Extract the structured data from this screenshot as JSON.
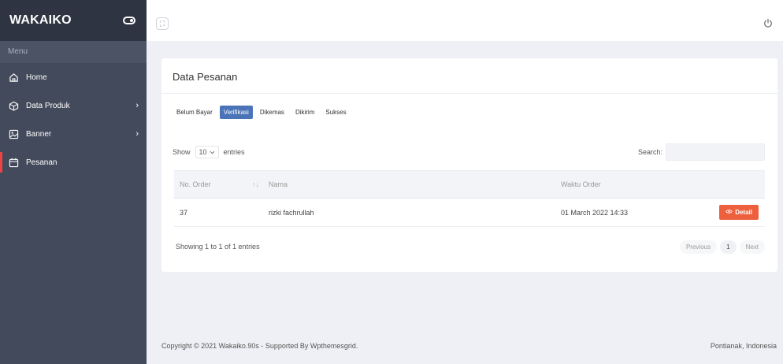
{
  "brand": {
    "name": "WAKAIKO"
  },
  "sidebar": {
    "heading": "Menu",
    "items": [
      {
        "label": "Home",
        "icon": "home-icon"
      },
      {
        "label": "Data Produk",
        "icon": "box-icon",
        "chevron": "›"
      },
      {
        "label": "Banner",
        "icon": "image-icon",
        "chevron": "›"
      },
      {
        "label": "Pesanan",
        "icon": "calendar-icon",
        "active": true
      }
    ]
  },
  "card": {
    "title": "Data Pesanan",
    "tabs": [
      "Belum Bayar",
      "Verifikasi",
      "Dikemas",
      "Dikirim",
      "Sukses"
    ],
    "active_tab": "Verifikasi"
  },
  "table_controls": {
    "show_label": "Show",
    "entries_value": "10",
    "entries_label": "entries",
    "search_label": "Search:",
    "search_value": ""
  },
  "table": {
    "columns": [
      "No. Order",
      "Nama",
      "Waktu Order",
      ""
    ],
    "rows": [
      {
        "no_order": "37",
        "nama": "rizki fachrullah",
        "waktu_order": "01 March 2022 14:33",
        "action": "Detail"
      }
    ]
  },
  "pagination": {
    "info": "Showing 1 to 1 of 1 entries",
    "previous": "Previous",
    "current": "1",
    "next": "Next"
  },
  "footer": {
    "left": "Copyright © 2021 Wakaiko.90s - Supported By Wpthemesgrid.",
    "right": "Pontianak, Indonesia"
  },
  "colors": {
    "sidebar_bg": "#434a5b",
    "brand_bg": "#2f3442",
    "active_tab": "#4a73b8",
    "detail_button": "#ee5f3d",
    "active_marker": "#ef4444"
  }
}
